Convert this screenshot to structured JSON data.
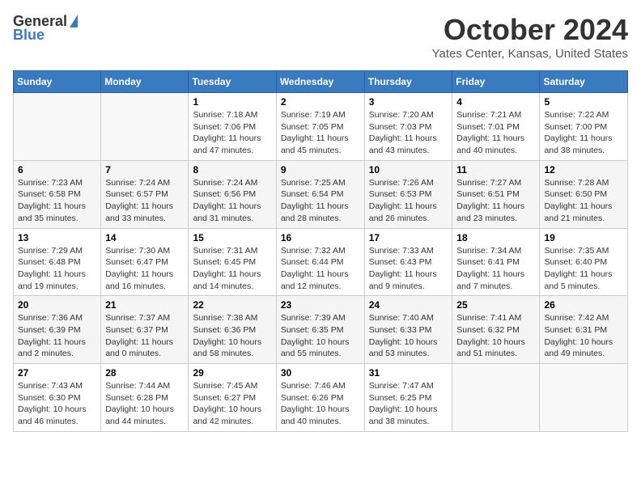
{
  "header": {
    "logo_general": "General",
    "logo_blue": "Blue",
    "month": "October 2024",
    "location": "Yates Center, Kansas, United States"
  },
  "calendar": {
    "days_of_week": [
      "Sunday",
      "Monday",
      "Tuesday",
      "Wednesday",
      "Thursday",
      "Friday",
      "Saturday"
    ],
    "weeks": [
      [
        {
          "day": "",
          "info": ""
        },
        {
          "day": "",
          "info": ""
        },
        {
          "day": "1",
          "info": "Sunrise: 7:18 AM\nSunset: 7:06 PM\nDaylight: 11 hours and 47 minutes."
        },
        {
          "day": "2",
          "info": "Sunrise: 7:19 AM\nSunset: 7:05 PM\nDaylight: 11 hours and 45 minutes."
        },
        {
          "day": "3",
          "info": "Sunrise: 7:20 AM\nSunset: 7:03 PM\nDaylight: 11 hours and 43 minutes."
        },
        {
          "day": "4",
          "info": "Sunrise: 7:21 AM\nSunset: 7:01 PM\nDaylight: 11 hours and 40 minutes."
        },
        {
          "day": "5",
          "info": "Sunrise: 7:22 AM\nSunset: 7:00 PM\nDaylight: 11 hours and 38 minutes."
        }
      ],
      [
        {
          "day": "6",
          "info": "Sunrise: 7:23 AM\nSunset: 6:58 PM\nDaylight: 11 hours and 35 minutes."
        },
        {
          "day": "7",
          "info": "Sunrise: 7:24 AM\nSunset: 6:57 PM\nDaylight: 11 hours and 33 minutes."
        },
        {
          "day": "8",
          "info": "Sunrise: 7:24 AM\nSunset: 6:56 PM\nDaylight: 11 hours and 31 minutes."
        },
        {
          "day": "9",
          "info": "Sunrise: 7:25 AM\nSunset: 6:54 PM\nDaylight: 11 hours and 28 minutes."
        },
        {
          "day": "10",
          "info": "Sunrise: 7:26 AM\nSunset: 6:53 PM\nDaylight: 11 hours and 26 minutes."
        },
        {
          "day": "11",
          "info": "Sunrise: 7:27 AM\nSunset: 6:51 PM\nDaylight: 11 hours and 23 minutes."
        },
        {
          "day": "12",
          "info": "Sunrise: 7:28 AM\nSunset: 6:50 PM\nDaylight: 11 hours and 21 minutes."
        }
      ],
      [
        {
          "day": "13",
          "info": "Sunrise: 7:29 AM\nSunset: 6:48 PM\nDaylight: 11 hours and 19 minutes."
        },
        {
          "day": "14",
          "info": "Sunrise: 7:30 AM\nSunset: 6:47 PM\nDaylight: 11 hours and 16 minutes."
        },
        {
          "day": "15",
          "info": "Sunrise: 7:31 AM\nSunset: 6:45 PM\nDaylight: 11 hours and 14 minutes."
        },
        {
          "day": "16",
          "info": "Sunrise: 7:32 AM\nSunset: 6:44 PM\nDaylight: 11 hours and 12 minutes."
        },
        {
          "day": "17",
          "info": "Sunrise: 7:33 AM\nSunset: 6:43 PM\nDaylight: 11 hours and 9 minutes."
        },
        {
          "day": "18",
          "info": "Sunrise: 7:34 AM\nSunset: 6:41 PM\nDaylight: 11 hours and 7 minutes."
        },
        {
          "day": "19",
          "info": "Sunrise: 7:35 AM\nSunset: 6:40 PM\nDaylight: 11 hours and 5 minutes."
        }
      ],
      [
        {
          "day": "20",
          "info": "Sunrise: 7:36 AM\nSunset: 6:39 PM\nDaylight: 11 hours and 2 minutes."
        },
        {
          "day": "21",
          "info": "Sunrise: 7:37 AM\nSunset: 6:37 PM\nDaylight: 11 hours and 0 minutes."
        },
        {
          "day": "22",
          "info": "Sunrise: 7:38 AM\nSunset: 6:36 PM\nDaylight: 10 hours and 58 minutes."
        },
        {
          "day": "23",
          "info": "Sunrise: 7:39 AM\nSunset: 6:35 PM\nDaylight: 10 hours and 55 minutes."
        },
        {
          "day": "24",
          "info": "Sunrise: 7:40 AM\nSunset: 6:33 PM\nDaylight: 10 hours and 53 minutes."
        },
        {
          "day": "25",
          "info": "Sunrise: 7:41 AM\nSunset: 6:32 PM\nDaylight: 10 hours and 51 minutes."
        },
        {
          "day": "26",
          "info": "Sunrise: 7:42 AM\nSunset: 6:31 PM\nDaylight: 10 hours and 49 minutes."
        }
      ],
      [
        {
          "day": "27",
          "info": "Sunrise: 7:43 AM\nSunset: 6:30 PM\nDaylight: 10 hours and 46 minutes."
        },
        {
          "day": "28",
          "info": "Sunrise: 7:44 AM\nSunset: 6:28 PM\nDaylight: 10 hours and 44 minutes."
        },
        {
          "day": "29",
          "info": "Sunrise: 7:45 AM\nSunset: 6:27 PM\nDaylight: 10 hours and 42 minutes."
        },
        {
          "day": "30",
          "info": "Sunrise: 7:46 AM\nSunset: 6:26 PM\nDaylight: 10 hours and 40 minutes."
        },
        {
          "day": "31",
          "info": "Sunrise: 7:47 AM\nSunset: 6:25 PM\nDaylight: 10 hours and 38 minutes."
        },
        {
          "day": "",
          "info": ""
        },
        {
          "day": "",
          "info": ""
        }
      ]
    ]
  }
}
